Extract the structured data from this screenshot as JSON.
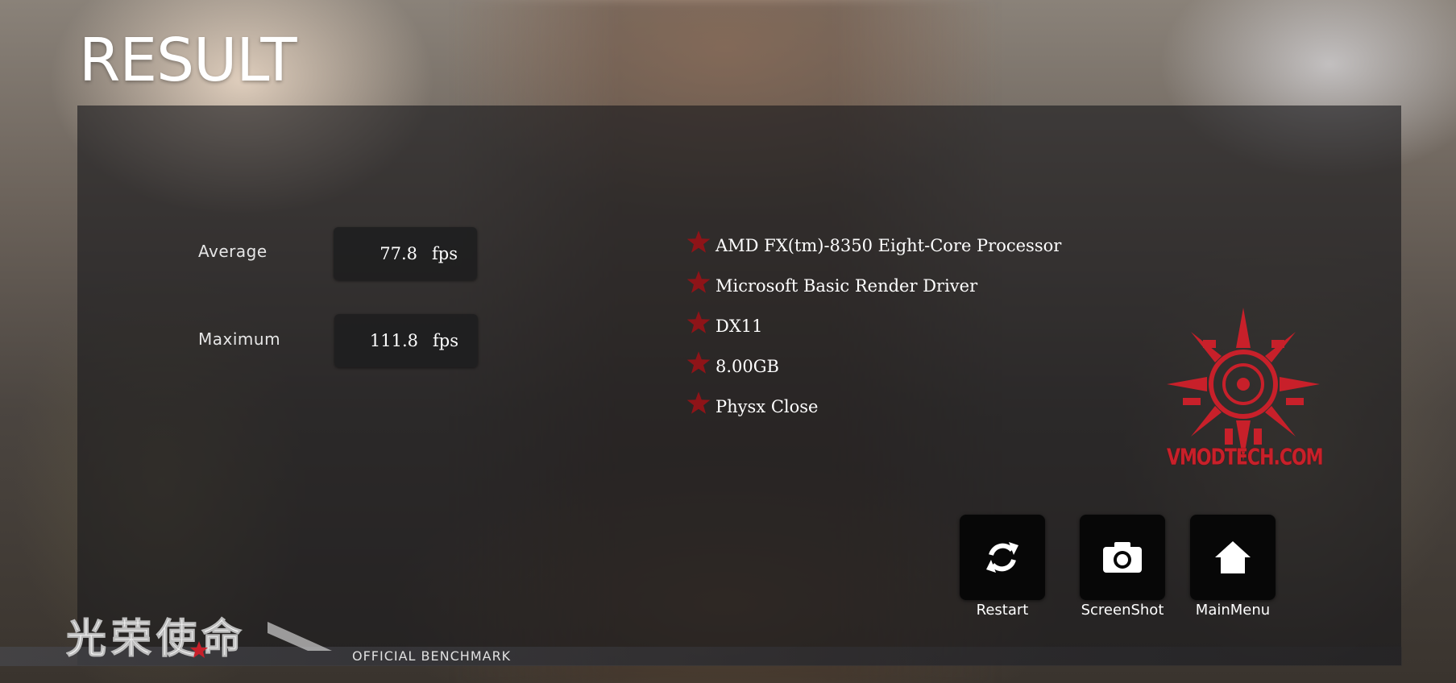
{
  "page": {
    "title": "RESULT"
  },
  "stats": [
    {
      "label": "Average",
      "value": "77.8",
      "unit": "fps"
    },
    {
      "label": "Maximum",
      "value": "111.8",
      "unit": "fps"
    }
  ],
  "specs": [
    "AMD FX(tm)-8350 Eight-Core Processor",
    "Microsoft Basic Render Driver",
    "DX11",
    "8.00GB",
    "Physx Close"
  ],
  "watermark": {
    "text": "VMODTECH.COM",
    "color": "#c8202a"
  },
  "actions": [
    {
      "label": "Restart",
      "icon": "refresh-icon"
    },
    {
      "label": "ScreenShot",
      "icon": "camera-icon"
    },
    {
      "label": "MainMenu",
      "icon": "home-icon"
    }
  ],
  "footer": {
    "game_logo_text": "光荣使命",
    "benchmark_label": "OFFICIAL BENCHMARK"
  },
  "colors": {
    "star": "#8e1418",
    "panel": "rgba(25,25,28,0.62)",
    "button": "#070707"
  }
}
